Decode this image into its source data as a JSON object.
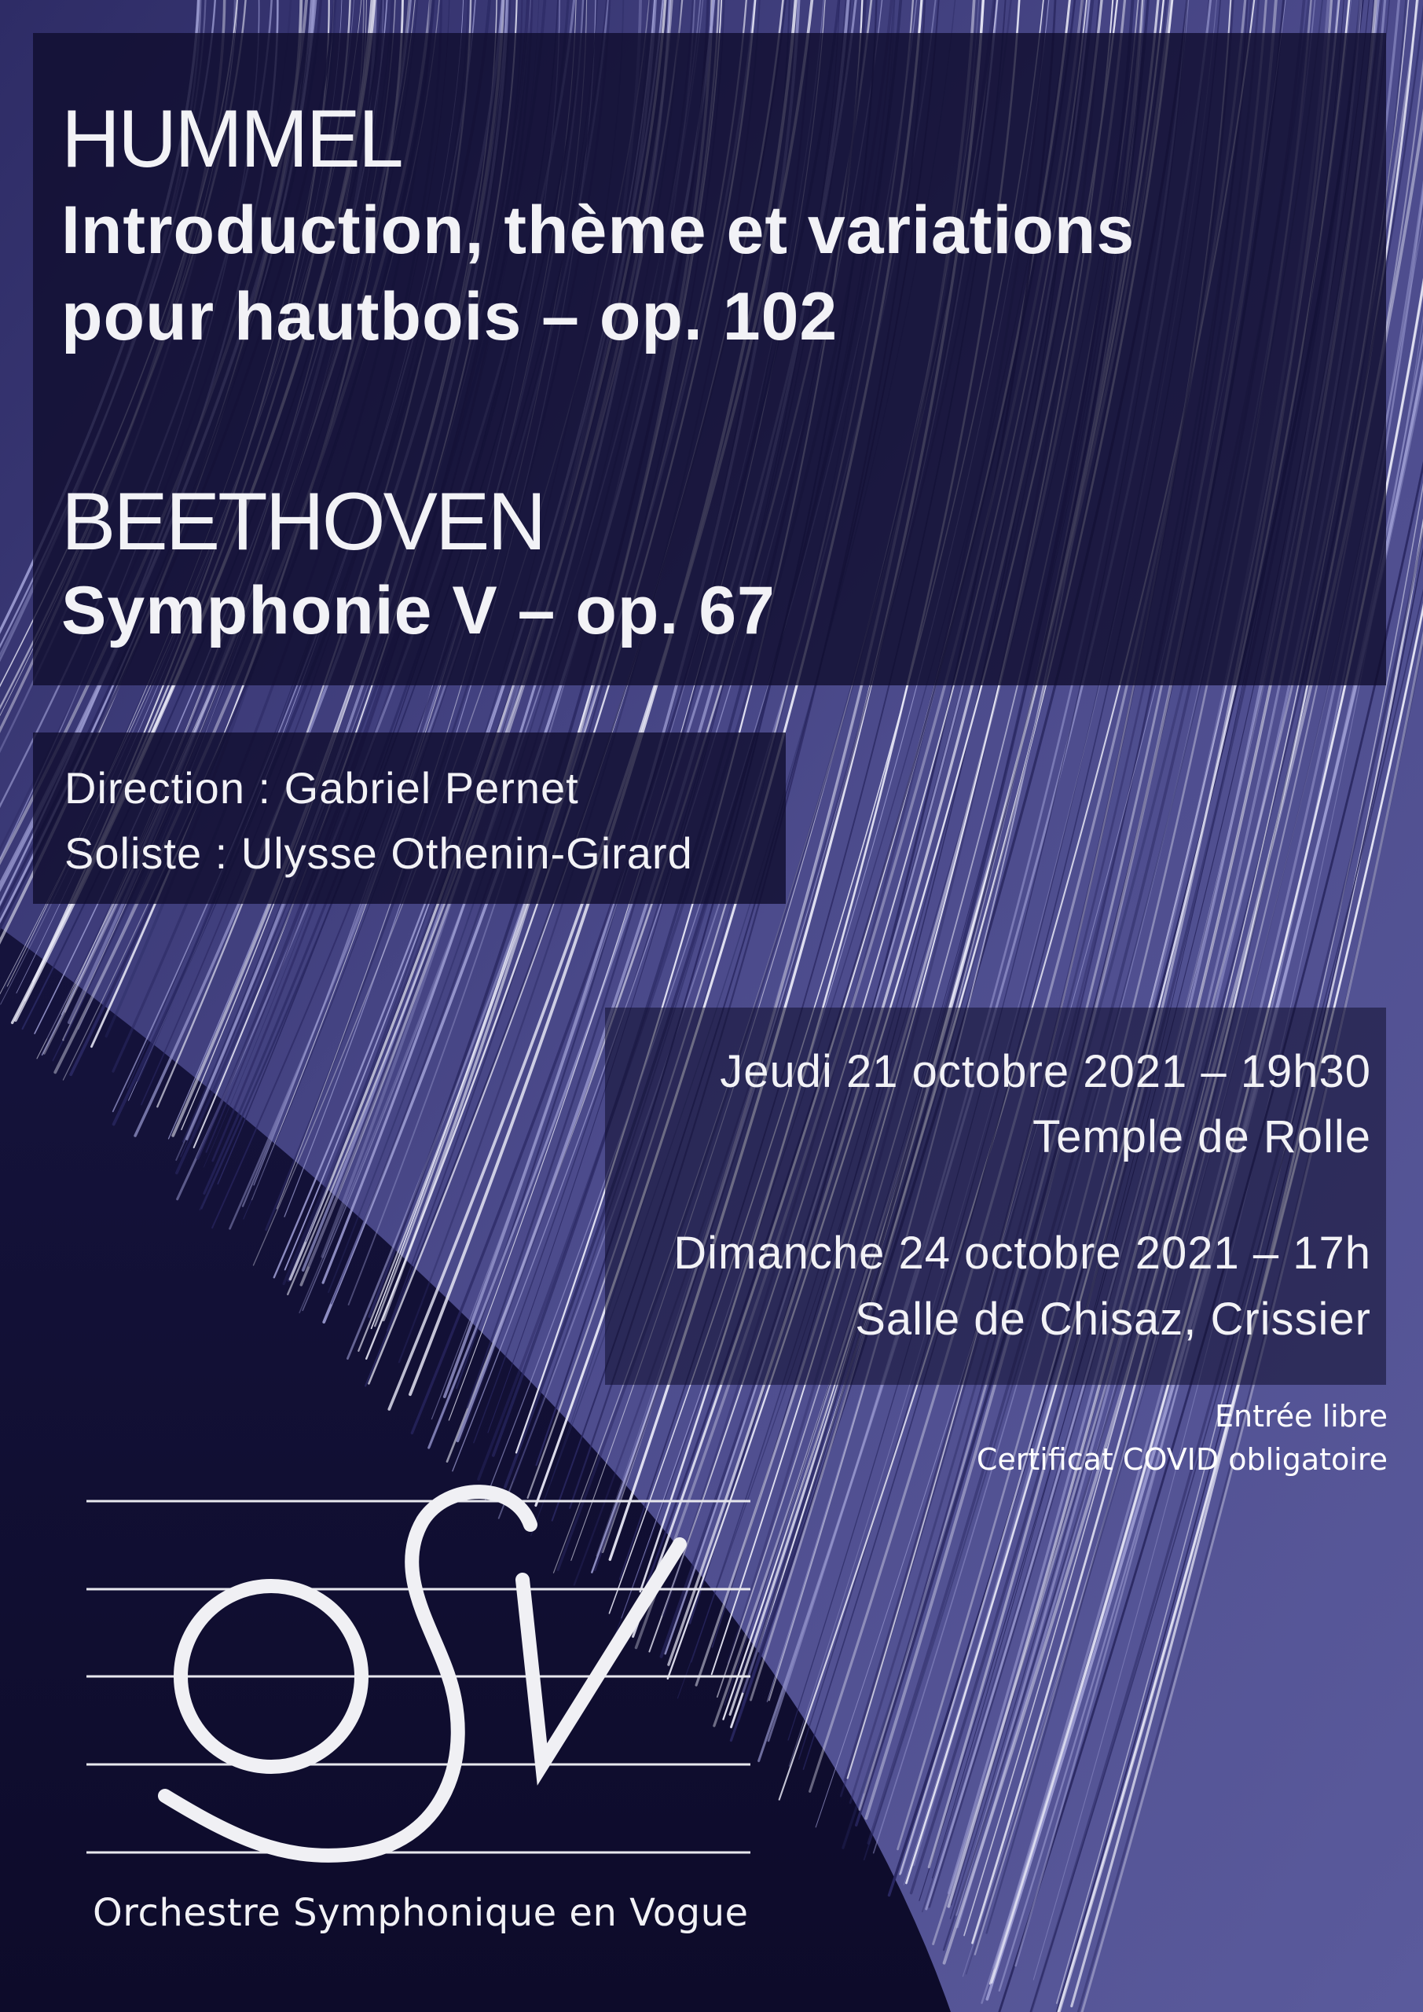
{
  "program": [
    {
      "composer": "HUMMEL",
      "work": "Introduction, thème et variations\npour hautbois – op. 102"
    },
    {
      "composer": "BEETHOVEN",
      "work": "Symphonie V – op. 67"
    }
  ],
  "credits": {
    "direction": "Direction : Gabriel Pernet",
    "soloist": "Soliste : Ulysse Othenin-Girard"
  },
  "concerts": [
    {
      "date": "Jeudi 21 octobre 2021 – 19h30",
      "venue": "Temple de Rolle"
    },
    {
      "date": "Dimanche 24 octobre 2021 – 17h",
      "venue": "Salle de Chisaz, Crissier"
    }
  ],
  "notes": {
    "entry": "Entrée libre",
    "covid": "Certificat COVID obligatoire"
  },
  "logo": {
    "orchestra_name": "Orchestre Symphonique en Vogue"
  },
  "colors": {
    "background_dark": "#14123a",
    "background_mid": "#4a4a88",
    "text": "#f2f2f6"
  }
}
